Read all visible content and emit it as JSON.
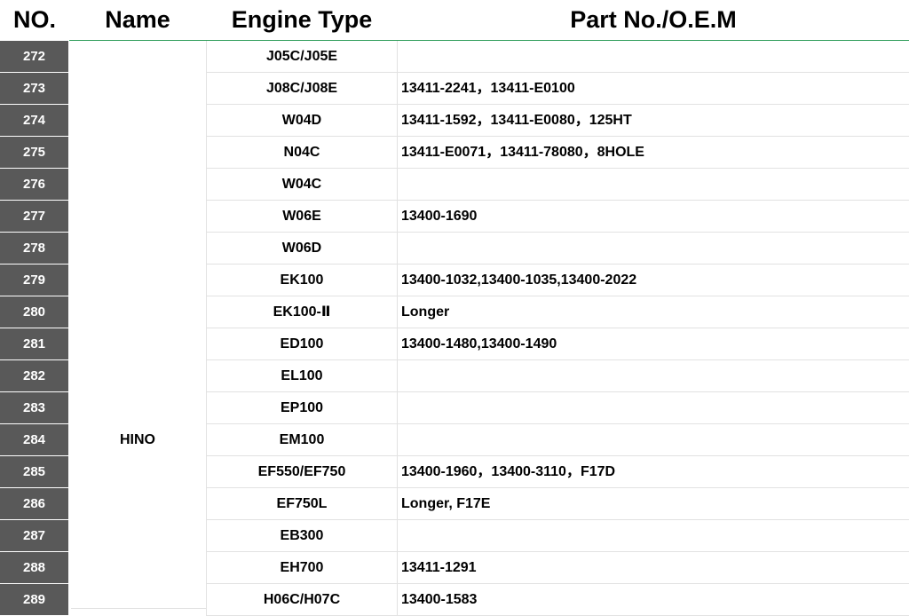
{
  "header": {
    "no": "NO.",
    "name": "Name",
    "engine_type": "Engine Type",
    "part_no": "Part No./O.E.M"
  },
  "group": {
    "name": "HINO"
  },
  "rows": [
    {
      "no": "272",
      "engine": "J05C/J05E",
      "part": ""
    },
    {
      "no": "273",
      "engine": "J08C/J08E",
      "part": "13411-2241，13411-E0100"
    },
    {
      "no": "274",
      "engine": "W04D",
      "part": "13411-1592，13411-E0080，125HT"
    },
    {
      "no": "275",
      "engine": "N04C",
      "part": "13411-E0071，13411-78080，8HOLE"
    },
    {
      "no": "276",
      "engine": "W04C",
      "part": ""
    },
    {
      "no": "277",
      "engine": "W06E",
      "part": "13400-1690"
    },
    {
      "no": "278",
      "engine": "W06D",
      "part": ""
    },
    {
      "no": "279",
      "engine": "EK100",
      "part": "13400-1032,13400-1035,13400-2022"
    },
    {
      "no": "280",
      "engine": "EK100-Ⅱ",
      "part": "Longer"
    },
    {
      "no": "281",
      "engine": "ED100",
      "part": "13400-1480,13400-1490"
    },
    {
      "no": "282",
      "engine": "EL100",
      "part": ""
    },
    {
      "no": "283",
      "engine": "EP100",
      "part": ""
    },
    {
      "no": "284",
      "engine": "EM100",
      "part": ""
    },
    {
      "no": "285",
      "engine": "EF550/EF750",
      "part": "13400-1960，13400-3110，F17D"
    },
    {
      "no": "286",
      "engine": "EF750L",
      "part": "Longer, F17E"
    },
    {
      "no": "287",
      "engine": "EB300",
      "part": ""
    },
    {
      "no": "288",
      "engine": "EH700",
      "part": "13411-1291"
    },
    {
      "no": "289",
      "engine": "H06C/H07C",
      "part": "13400-1583"
    }
  ]
}
